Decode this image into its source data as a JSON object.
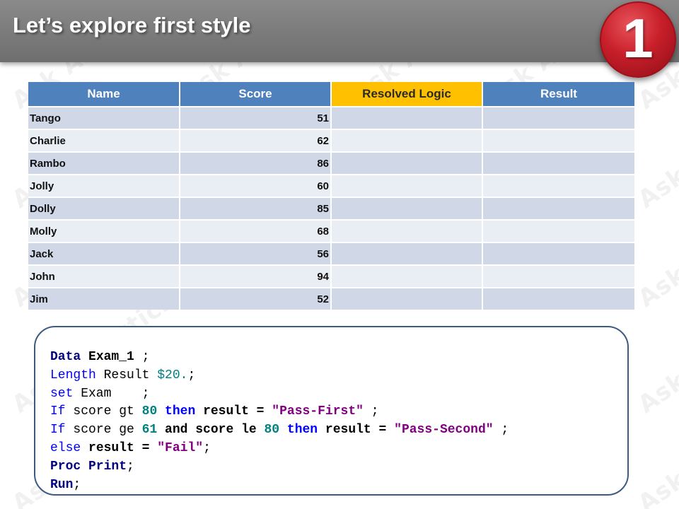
{
  "slide": {
    "title": "Let’s explore first style",
    "badge_number": "1",
    "watermark_text": "Ask Analytics"
  },
  "table": {
    "headers": [
      "Name",
      "Score",
      "Resolved Logic",
      "Result"
    ],
    "rows": [
      {
        "name": "Tango",
        "score": "51",
        "logic": "",
        "result": ""
      },
      {
        "name": "Charlie",
        "score": "62",
        "logic": "",
        "result": ""
      },
      {
        "name": "Rambo",
        "score": "86",
        "logic": "",
        "result": ""
      },
      {
        "name": "Jolly",
        "score": "60",
        "logic": "",
        "result": ""
      },
      {
        "name": "Dolly",
        "score": "85",
        "logic": "",
        "result": ""
      },
      {
        "name": "Molly",
        "score": "68",
        "logic": "",
        "result": ""
      },
      {
        "name": "Jack",
        "score": "56",
        "logic": "",
        "result": ""
      },
      {
        "name": "John",
        "score": "94",
        "logic": "",
        "result": ""
      },
      {
        "name": "Jim",
        "score": "52",
        "logic": "",
        "result": ""
      }
    ]
  },
  "code": {
    "l1": {
      "a": "Data",
      "b": " Exam_1",
      "c": " ;"
    },
    "l2": {
      "a": "Length",
      "b": " Result ",
      "c": "$20.",
      "d": ";"
    },
    "l3": {
      "a": "set",
      "b": " Exam    ;"
    },
    "l4": {
      "a": "If",
      "b": " score gt ",
      "c": "80",
      "d": " then",
      "e": " result = ",
      "f": "\"Pass-First\"",
      "g": " ;"
    },
    "l5": {
      "a": "If",
      "b": " score ge ",
      "c": "61",
      "d": " and score le ",
      "e": "80",
      "f": " then",
      "g": " result = ",
      "h": "\"Pass-Second\"",
      "i": " ;"
    },
    "l6": {
      "a": "else",
      "b": " result = ",
      "c": "\"Fail\"",
      "d": ";"
    },
    "l7": {
      "a": "Proc Print",
      "b": ";"
    },
    "l8": {
      "a": "Run",
      "b": ";"
    }
  },
  "colors": {
    "header_blue": "#4f81bd",
    "header_gold": "#ffc000",
    "row_dark": "#d0d8e8",
    "row_light": "#e9edf4",
    "badge_red": "#c81f2a",
    "title_bar": "#7a7a7a"
  }
}
